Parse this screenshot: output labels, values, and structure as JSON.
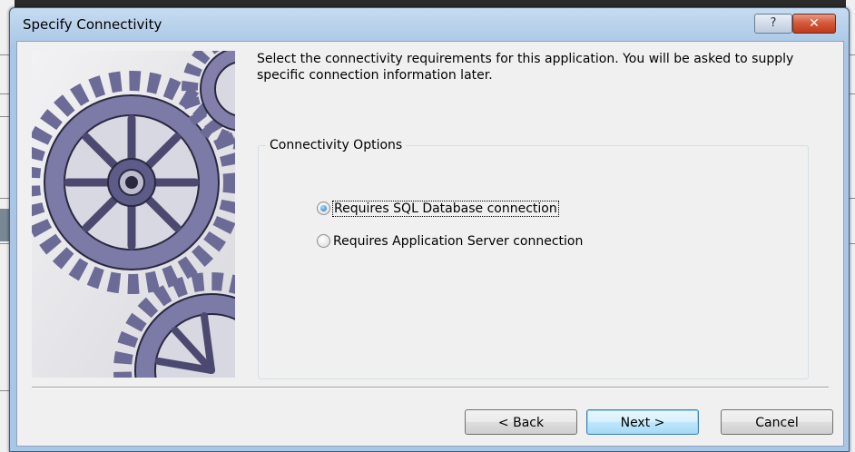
{
  "dialog": {
    "title": "Specify Connectivity",
    "help_symbol": "?",
    "close_symbol": "✕",
    "intro_text": "Select the connectivity requirements for this application.  You will be asked to supply specific connection information later."
  },
  "connectivity": {
    "group_label": "Connectivity Options",
    "options": [
      {
        "label": "Requires SQL Database connection",
        "mnemonic": "D",
        "selected": true
      },
      {
        "label": "Requires Application Server connection",
        "mnemonic": "A",
        "selected": false
      }
    ]
  },
  "buttons": {
    "back": "< Back",
    "next": "Next >",
    "cancel": "Cancel"
  },
  "colors": {
    "titlebar": "#a9c6e6",
    "close_button": "#c0391b",
    "client_bg": "#f0f0f0",
    "gear_art": "#6c6a96"
  },
  "icons": {
    "help": "question-mark-icon",
    "close": "close-icon",
    "banner": "gears-illustration"
  }
}
